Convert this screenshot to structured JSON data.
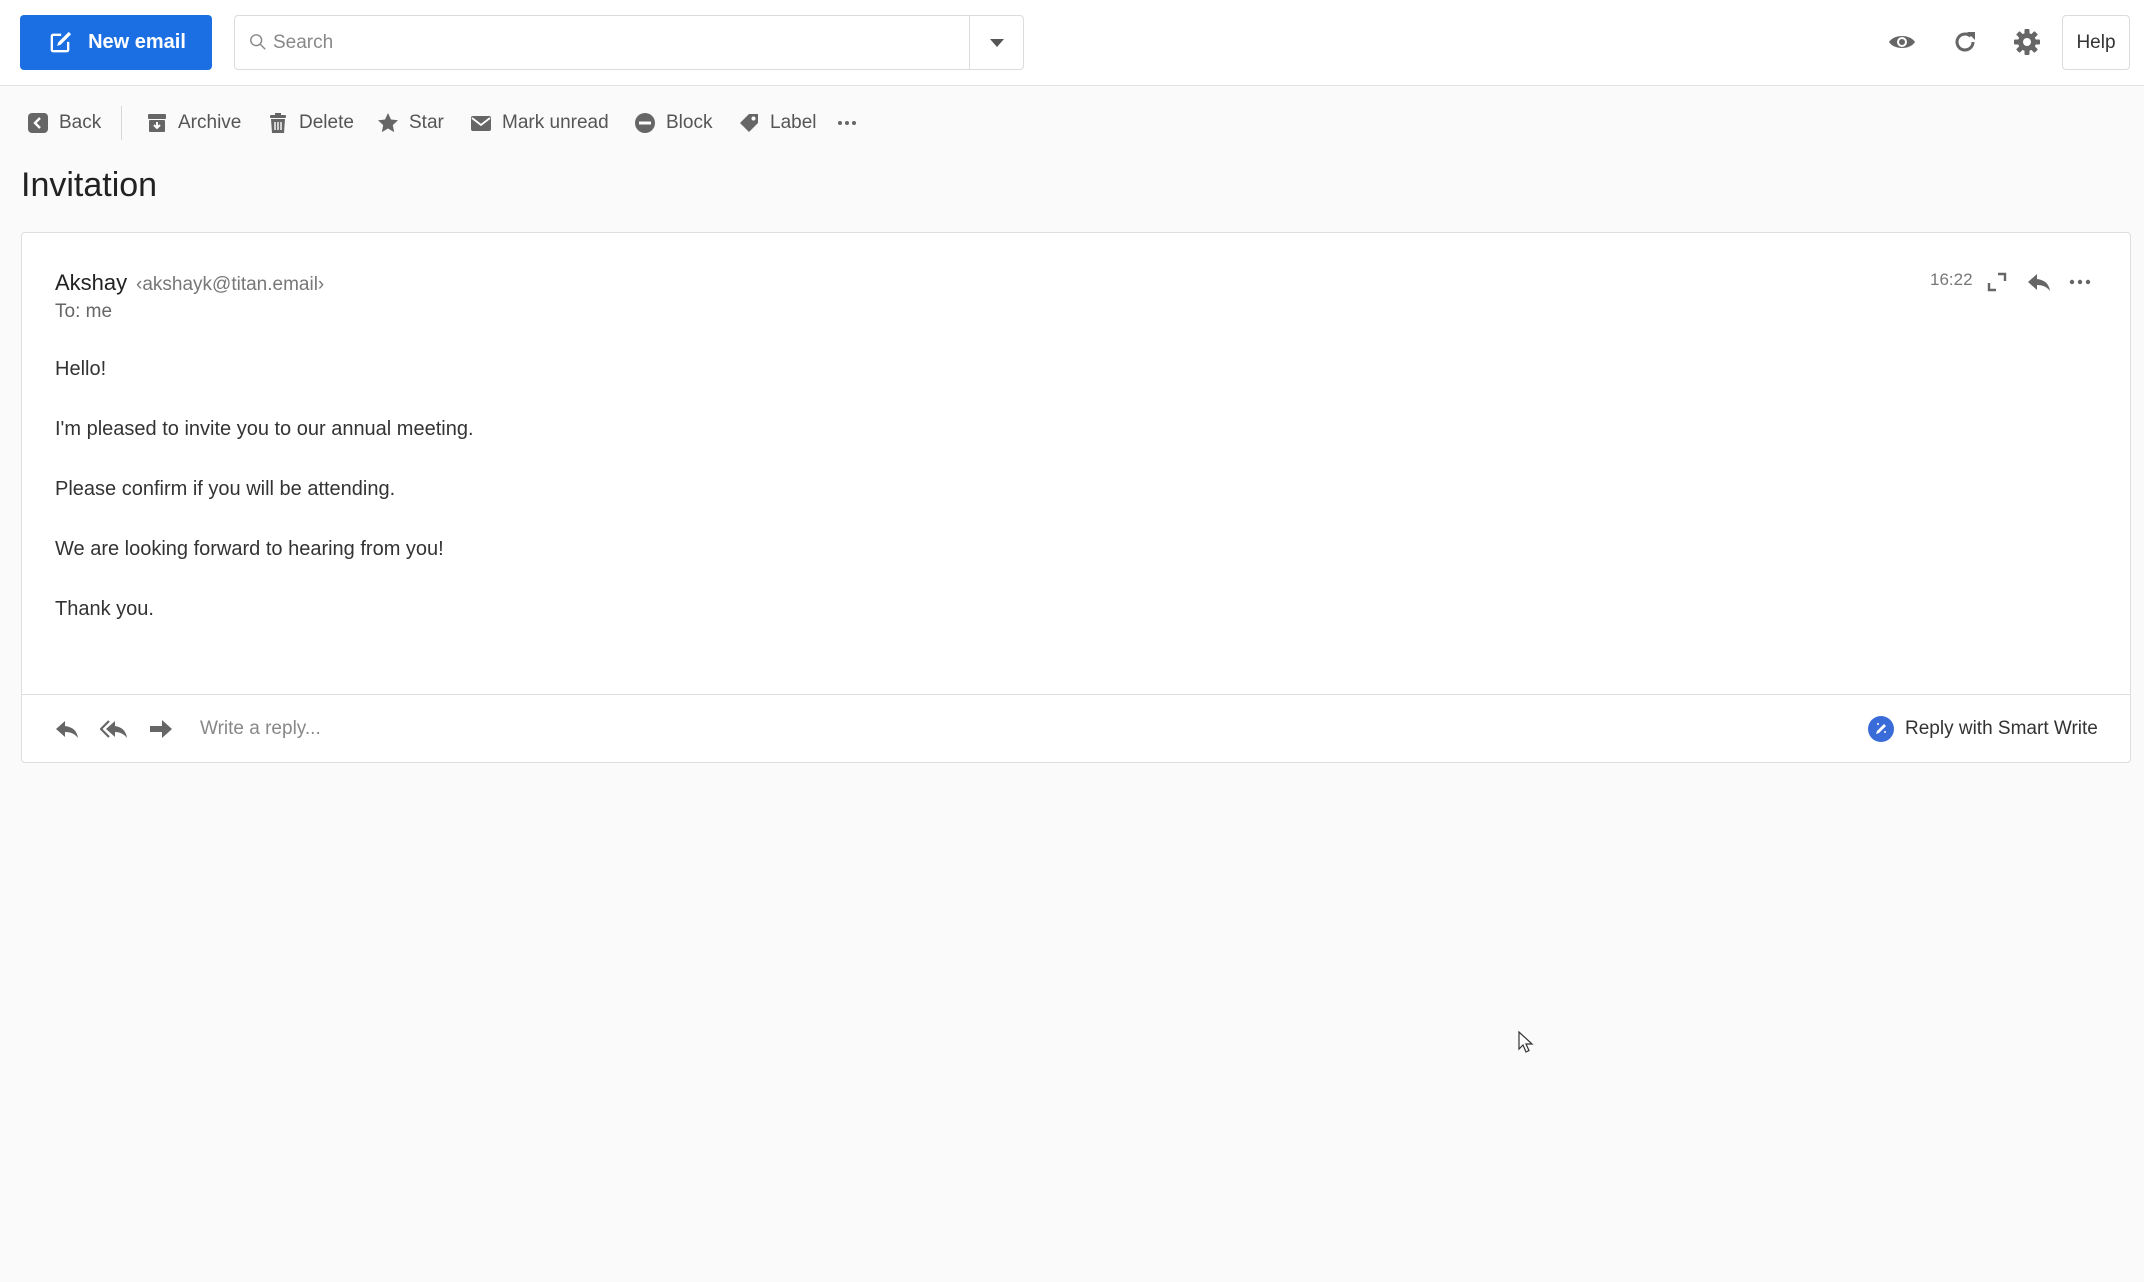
{
  "topbar": {
    "new_email_label": "New email",
    "search_placeholder": "Search",
    "help_label": "Help",
    "icons": [
      "eye-icon",
      "refresh-icon",
      "gear-icon"
    ]
  },
  "toolbar": {
    "back": "Back",
    "archive": "Archive",
    "delete": "Delete",
    "star": "Star",
    "mark_unread": "Mark unread",
    "block": "Block",
    "label": "Label"
  },
  "message": {
    "subject": "Invitation",
    "sender_name": "Akshay",
    "sender_email": "‹akshayk@titan.email›",
    "to_line": "To: me",
    "time": "16:22",
    "body": [
      "Hello!",
      "I'm pleased to invite you to our annual meeting.",
      "Please confirm if you will be attending.",
      "We are looking forward to hearing from you!",
      "Thank you."
    ]
  },
  "reply": {
    "placeholder": "Write a reply...",
    "smart_write_label": "Reply with Smart Write"
  },
  "colors": {
    "accent": "#1c6fe3",
    "smart_write_badge": "#3a6cd9",
    "icon_gray": "#666666"
  }
}
